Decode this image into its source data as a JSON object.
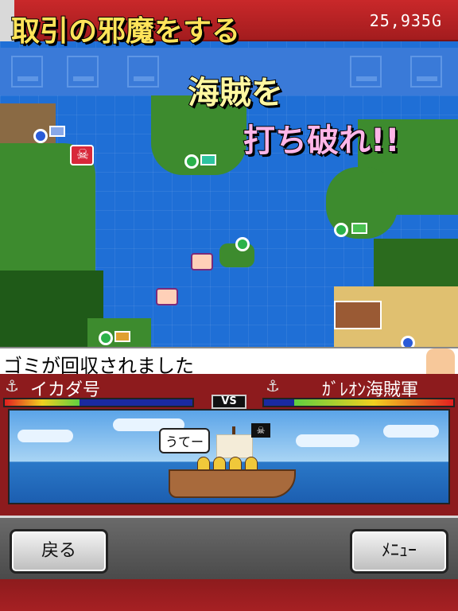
{
  "header": {
    "gold": "25,935G"
  },
  "headlines": {
    "line1": "取引の邪魔をする",
    "line2": "海賊を",
    "line3": "打ち破れ!!"
  },
  "message": {
    "text": "ゴミが回収されました"
  },
  "battle": {
    "left_ship_name": "イカダ号",
    "right_ship_name": "ｶﾞﾚｵﾝ海賊軍",
    "vs_label": "VS",
    "speech": "うてー"
  },
  "buttons": {
    "back": "戻る",
    "menu": "ﾒﾆｭｰ"
  },
  "icons": {
    "anchor": "anchor-icon",
    "pirate": "skull-icon",
    "town_pin": "map-pin-icon"
  },
  "colors": {
    "header_red": "#c9282a",
    "sea_blue": "#1f6fd6",
    "land_green": "#3d8b2e"
  }
}
